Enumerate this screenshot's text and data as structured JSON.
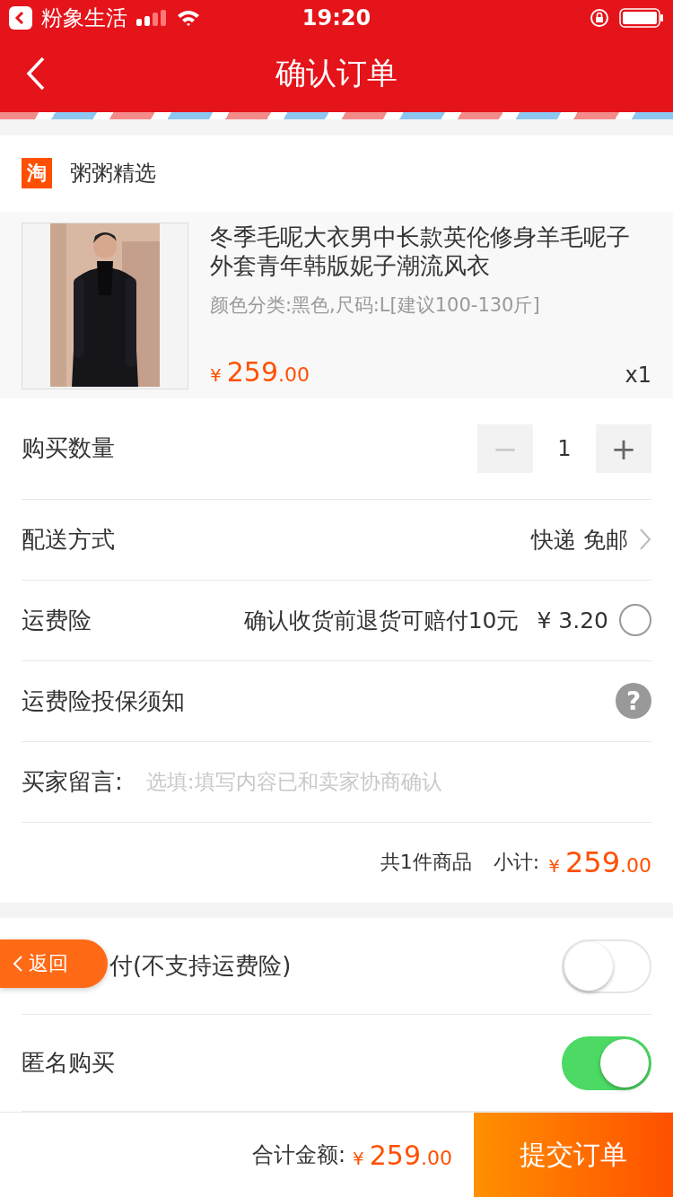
{
  "status_bar": {
    "back_app": "粉象生活",
    "time": "19:20"
  },
  "nav": {
    "title": "确认订单"
  },
  "shop": {
    "name": "粥粥精选",
    "logo": "淘"
  },
  "product": {
    "title": "冬季毛呢大衣男中长款英伦修身羊毛呢子外套青年韩版妮子潮流风衣",
    "spec": "颜色分类:黑色,尺码:L[建议100-130斤]",
    "currency": "¥",
    "price_int": "259",
    "price_dec": ".00",
    "count": "x1"
  },
  "quantity": {
    "label": "购买数量",
    "minus": "−",
    "value": "1",
    "plus": "+",
    "minus_disabled": true
  },
  "shipping": {
    "label": "配送方式",
    "value": "快递 免邮"
  },
  "insurance": {
    "label": "运费险",
    "desc": "确认收货前退货可赔付10元",
    "price": "¥ 3.20",
    "checked": false
  },
  "notice": {
    "label": "运费险投保须知",
    "icon": "?"
  },
  "message": {
    "label": "买家留言:",
    "placeholder": "选填:填写内容已和卖家协商确认"
  },
  "subtotal": {
    "items": "共1件商品",
    "label": "小计:",
    "currency": "¥",
    "price_int": "259",
    "price_dec": ".00"
  },
  "options": [
    {
      "label": "付(不支持运费险)",
      "on": false
    },
    {
      "label": "匿名购买",
      "on": true
    }
  ],
  "float_back": {
    "label": "返回"
  },
  "footer": {
    "label": "合计金额:",
    "currency": "¥",
    "price_int": "259",
    "price_dec": ".00",
    "submit": "提交订单"
  }
}
